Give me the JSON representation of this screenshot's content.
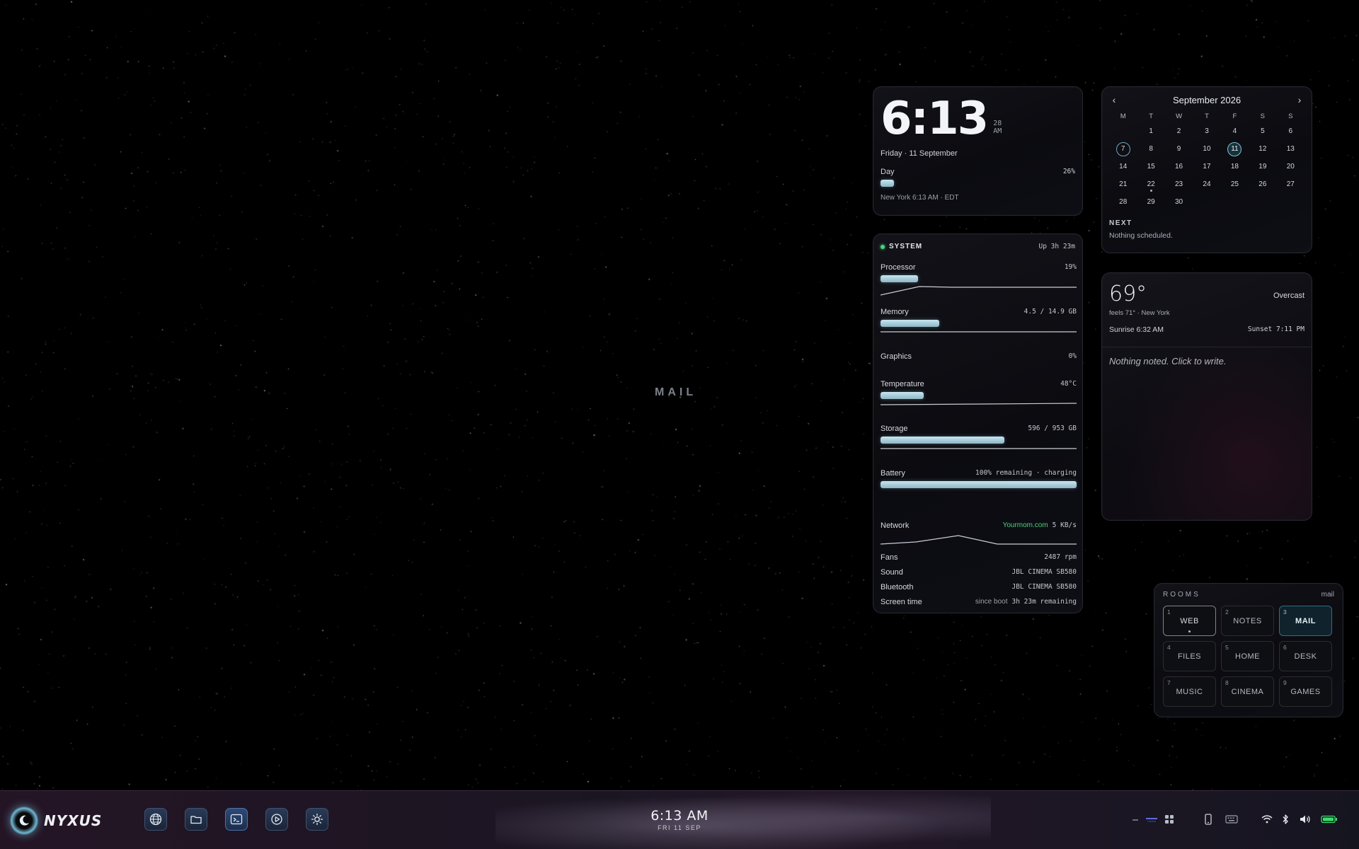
{
  "desktop": {
    "room_watermark": "MAIL"
  },
  "clock": {
    "time": "6:13",
    "seconds": "28",
    "meridiem": "AM",
    "date": "Friday · 11 September",
    "day_label": "Day",
    "day_percent_text": "26%",
    "day_progress": 0.26,
    "location": "New York 6:13 AM · EDT"
  },
  "system": {
    "title": "SYSTEM",
    "uptime": "Up 3h 23m",
    "processor": {
      "label": "Processor",
      "value": "19%",
      "fill": 0.19
    },
    "memory": {
      "label": "Memory",
      "value": "4.5 / 14.9 GB",
      "fill": 0.3
    },
    "graphics": {
      "label": "Graphics",
      "value": "0%"
    },
    "temperature": {
      "label": "Temperature",
      "value": "48°C",
      "fill": 0.22
    },
    "storage": {
      "label": "Storage",
      "value": "596 / 953 GB",
      "fill": 0.63
    },
    "battery": {
      "label": "Battery",
      "value": "100% remaining · charging",
      "fill": 1.0
    },
    "network": {
      "label": "Network",
      "ssid": "Yourmom.com",
      "rate": "5 KB/s"
    },
    "fans": {
      "label": "Fans",
      "value": "2487 rpm"
    },
    "sound": {
      "label": "Sound",
      "value": "JBL CINEMA SB580"
    },
    "bluetooth": {
      "label": "Bluetooth",
      "value": "JBL CINEMA SB580"
    },
    "screen_time": {
      "label": "Screen time",
      "note": "since boot",
      "value": "3h 23m remaining"
    }
  },
  "calendar": {
    "month_title": "September 2026",
    "weekdays": [
      "M",
      "T",
      "W",
      "T",
      "F",
      "S",
      "S"
    ],
    "weeks": [
      [
        "",
        "1",
        "2",
        "3",
        "4",
        "5",
        "6"
      ],
      [
        "7",
        "8",
        "9",
        "10",
        "11",
        "12",
        "13"
      ],
      [
        "14",
        "15",
        "16",
        "17",
        "18",
        "19",
        "20"
      ],
      [
        "21",
        "22",
        "23",
        "24",
        "25",
        "26",
        "27"
      ],
      [
        "28",
        "29",
        "30",
        "",
        "",
        "",
        ""
      ]
    ],
    "circled_days": [
      "7",
      "11"
    ],
    "today": "11",
    "event_days": [
      "22"
    ],
    "next_label": "NEXT",
    "next_value": "Nothing scheduled."
  },
  "weather": {
    "temperature": "69°",
    "condition": "Overcast",
    "feels": "feels 71° · New York",
    "sunrise": "Sunrise 6:32 AM",
    "sunset": "Sunset 7:11 PM"
  },
  "notes": {
    "placeholder": "Nothing noted. Click to write."
  },
  "rooms": {
    "title": "ROOMS",
    "current_label": "mail",
    "items": [
      {
        "num": "1",
        "label": "WEB",
        "state": "current"
      },
      {
        "num": "2",
        "label": "NOTES",
        "state": ""
      },
      {
        "num": "3",
        "label": "MAIL",
        "state": "active"
      },
      {
        "num": "4",
        "label": "FILES",
        "state": ""
      },
      {
        "num": "5",
        "label": "HOME",
        "state": ""
      },
      {
        "num": "6",
        "label": "DESK",
        "state": ""
      },
      {
        "num": "7",
        "label": "MUSIC",
        "state": ""
      },
      {
        "num": "8",
        "label": "CINEMA",
        "state": ""
      },
      {
        "num": "9",
        "label": "GAMES",
        "state": ""
      }
    ]
  },
  "taskbar": {
    "brand": "NYXUS",
    "time": "6:13 AM",
    "date": "FRI 11 SEP",
    "dock_icons": [
      "globe-icon",
      "folder-icon",
      "terminal-icon",
      "media-player-icon",
      "settings-sun-icon"
    ],
    "tray_icons": [
      "minimize-icon",
      "layout-icon",
      "grid-icon",
      "phone-icon",
      "keyboard-icon",
      "wifi-icon",
      "bluetooth-icon",
      "volume-icon",
      "battery-icon"
    ],
    "accent": "#6fb6cf",
    "battery_color": "#3ddc6e"
  }
}
